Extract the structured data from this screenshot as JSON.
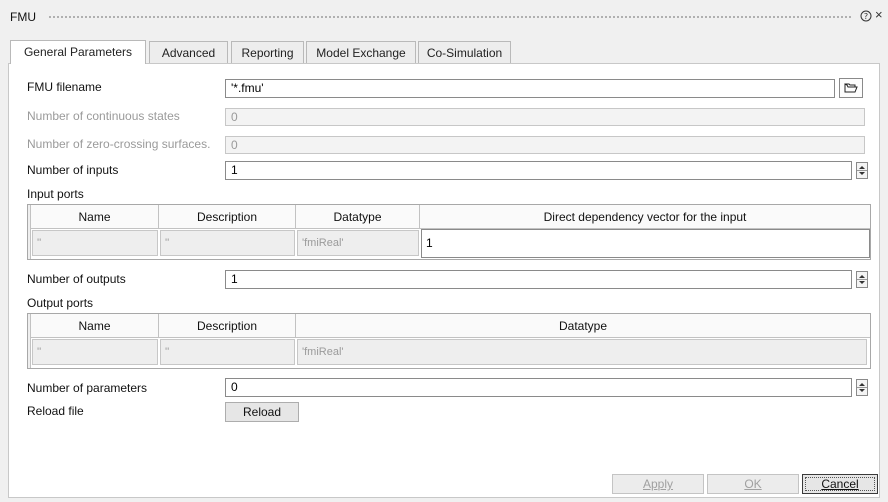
{
  "window": {
    "title": "FMU",
    "help_label": "?",
    "close_label": "×"
  },
  "tabs": [
    {
      "label": "General Parameters",
      "active": true
    },
    {
      "label": "Advanced",
      "active": false
    },
    {
      "label": "Reporting",
      "active": false
    },
    {
      "label": "Model Exchange",
      "active": false
    },
    {
      "label": "Co-Simulation",
      "active": false
    }
  ],
  "fields": {
    "fmu_filename": {
      "label": "FMU filename",
      "value": "'*.fmu'"
    },
    "continuous_states": {
      "label": "Number of continuous states",
      "value": "0"
    },
    "zero_crossing": {
      "label": "Number of zero-crossing surfaces.",
      "value": "0"
    },
    "num_inputs": {
      "label": "Number of inputs",
      "value": "1"
    },
    "num_outputs": {
      "label": "Number of outputs",
      "value": "1"
    },
    "num_parameters": {
      "label": "Number of parameters",
      "value": "0"
    },
    "reload_file": {
      "label": "Reload file",
      "button": "Reload"
    }
  },
  "input_ports": {
    "title": "Input ports",
    "columns": [
      "Name",
      "Description",
      "Datatype",
      "Direct dependency vector for the input"
    ],
    "rows": [
      [
        "''",
        "''",
        "'fmiReal'",
        "1"
      ]
    ]
  },
  "output_ports": {
    "title": "Output ports",
    "columns": [
      "Name",
      "Description",
      "Datatype"
    ],
    "rows": [
      [
        "''",
        "''",
        "'fmiReal'"
      ]
    ]
  },
  "footer": {
    "apply": "Apply",
    "ok": "OK",
    "cancel": "Cancel"
  },
  "icons": {
    "folder": "folder-open-icon",
    "spin": "spin-updown-icon",
    "help": "help-circle-icon"
  }
}
